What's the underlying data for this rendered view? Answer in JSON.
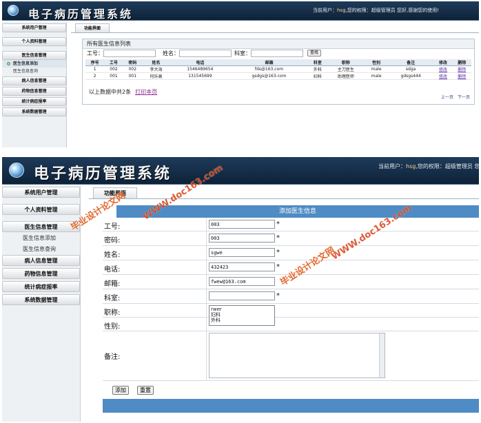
{
  "colors": {
    "header": "#0e2238",
    "accent": "#4f8bc4",
    "watermark": "#e05a1a"
  },
  "header": {
    "title": "电子病历管理系统",
    "user_prefix": "当前用户：",
    "user_name": "hsg",
    "user_suffix": ",您的权限：超级管理员 您好,感谢您的使用!",
    "user_suffix_short": ",您的权限：超级管理员 您"
  },
  "sidebar": {
    "items": {
      "user_mgmt": "系统用户管理",
      "personal": "个人资料管理",
      "doctor_info": "医生信息管理",
      "doctor_add": "医生信息添加",
      "doctor_query": "医生信息查询",
      "patient_info": "病人信息管理",
      "drug_info": "药物信息管理",
      "stats": "统计病症报率",
      "data_mgmt": "系统数据管理"
    }
  },
  "list_view": {
    "tab": "功能界面",
    "panel_title": "所有医生信息列表",
    "search": {
      "id_label": "工号：",
      "name_label": "姓名：",
      "dept_label": "科室：",
      "button": "查找"
    },
    "columns": [
      "序号",
      "工号",
      "密码",
      "姓名",
      "电话",
      "邮箱",
      "科室",
      "职称",
      "性别",
      "备注",
      "修改",
      "删除"
    ],
    "rows": [
      [
        "1",
        "002",
        "002",
        "李大海",
        "1546489654",
        "fds@163.com",
        "外科",
        "主刀医生",
        "male",
        "sdga",
        "修改",
        "删除"
      ],
      [
        "2",
        "001",
        "001",
        "何乐高",
        "131545699",
        "gsdgs@163.com",
        "妇科",
        "助理医师",
        "male",
        "gdsgs444",
        "修改",
        "删除"
      ]
    ],
    "pager": {
      "prev": "上一页",
      "next": "下一页"
    },
    "summary": "以上数据中共2条",
    "print_link": "打印本页"
  },
  "form_view": {
    "tab": "功能界面",
    "heading": "添加医生信息",
    "fields": {
      "id_label": "工号:",
      "id_value": "003",
      "pwd_label": "密码:",
      "pwd_value": "003",
      "name_label": "姓名:",
      "name_value": "sgwe",
      "phone_label": "电话:",
      "phone_value": "432423",
      "email_label": "邮箱:",
      "email_value": "fwew@163.com",
      "dept_label": "科室:",
      "dept_value": "",
      "title_label": "职称:",
      "sex_label": "性别:",
      "remark_label": "备注:"
    },
    "required_mark": "*",
    "dept_options": [
      "rwer",
      "妇科",
      "外科"
    ],
    "buttons": {
      "add": "添加",
      "reset": "重置"
    }
  },
  "watermark": {
    "url": "WWW.doc163.com",
    "cn": "毕业设计论文网"
  }
}
